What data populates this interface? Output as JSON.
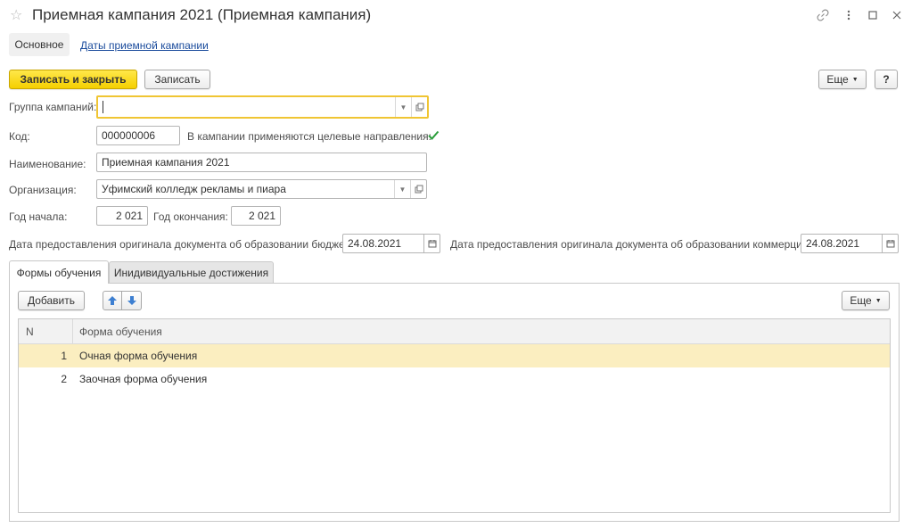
{
  "window": {
    "title": "Приемная кампания 2021 (Приемная кампания)",
    "star_icon": "star-outline-icon",
    "link_icon": "link-icon",
    "more_icon": "more-vertical-icon",
    "maximize_icon": "maximize-icon",
    "close_icon": "close-icon"
  },
  "sections": {
    "main": "Основное",
    "dates": "Даты приемной кампании"
  },
  "toolbar": {
    "save_close": "Записать и закрыть",
    "save": "Записать",
    "more": "Еще",
    "help": "?"
  },
  "form": {
    "group_label": "Группа кампаний:",
    "group_value": "",
    "code_label": "Код:",
    "code_value": "000000006",
    "directions_label": "В кампании применяются целевые направления:",
    "directions_checked": true,
    "name_label": "Наименование:",
    "name_value": "Приемная кампания 2021",
    "org_label": "Организация:",
    "org_value": "Уфимский колледж рекламы и пиара",
    "year_start_label": "Год начала:",
    "year_start_value": "2 021",
    "year_end_label": "Год окончания:",
    "year_end_value": "2 021",
    "budget_date_label": "Дата предоставления оригинала документа об образовании бюджет:",
    "budget_date_value": "24.08.2021",
    "commerce_date_label": "Дата предоставления оригинала документа об образовании коммерция:",
    "commerce_date_value": "24.08.2021"
  },
  "tabs": [
    {
      "label": "Формы обучения",
      "active": true
    },
    {
      "label": "Инидивидуальные достижения",
      "active": false
    }
  ],
  "panel": {
    "add": "Добавить",
    "more": "Еще",
    "up_icon": "arrow-up-icon",
    "down_icon": "arrow-down-icon"
  },
  "table": {
    "columns": [
      "N",
      "Форма обучения"
    ],
    "rows": [
      {
        "n": "1",
        "form": "Очная форма обучения",
        "selected": true
      },
      {
        "n": "2",
        "form": "Заочная форма обучения",
        "selected": false
      }
    ]
  },
  "colors": {
    "accent_yellow": "#f5cf00",
    "focus_border": "#f0c533",
    "selected_row": "#fbeec0",
    "link": "#1a4b9c",
    "check_green": "#2a9d3a",
    "arrow_blue": "#3d7fd1"
  }
}
